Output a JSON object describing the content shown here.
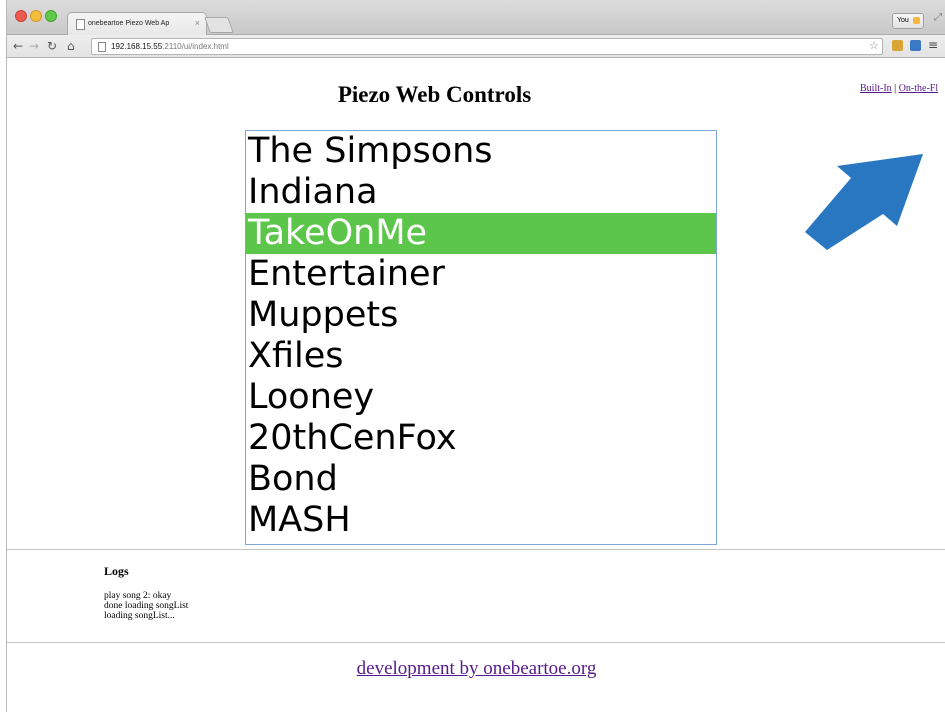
{
  "browser": {
    "tab_title": "onebeartoe Piezo Web Ap",
    "tab_close": "×",
    "profile_label": "You",
    "url_host": "192.168.15.55",
    "url_rest": ":2110/ui/index.html"
  },
  "page": {
    "title": "Piezo Web Controls",
    "modes": {
      "builtin": "Built-In",
      "separator": "|",
      "onthefly": "On-the-Fl"
    },
    "songs": [
      "The Simpsons",
      "Indiana",
      "TakeOnMe",
      "Entertainer",
      "Muppets",
      "Xfiles",
      "Looney",
      "20thCenFox",
      "Bond",
      "MASH"
    ],
    "selected_song": "TakeOnMe",
    "logs_heading": "Logs",
    "logs": [
      "play song 2: okay",
      "done loading songList",
      "loading songList..."
    ],
    "footer_link": "development by onebeartoe.org"
  },
  "colors": {
    "selection": "#5cc64b",
    "arrow": "#2877c0",
    "link": "#551a8b"
  }
}
